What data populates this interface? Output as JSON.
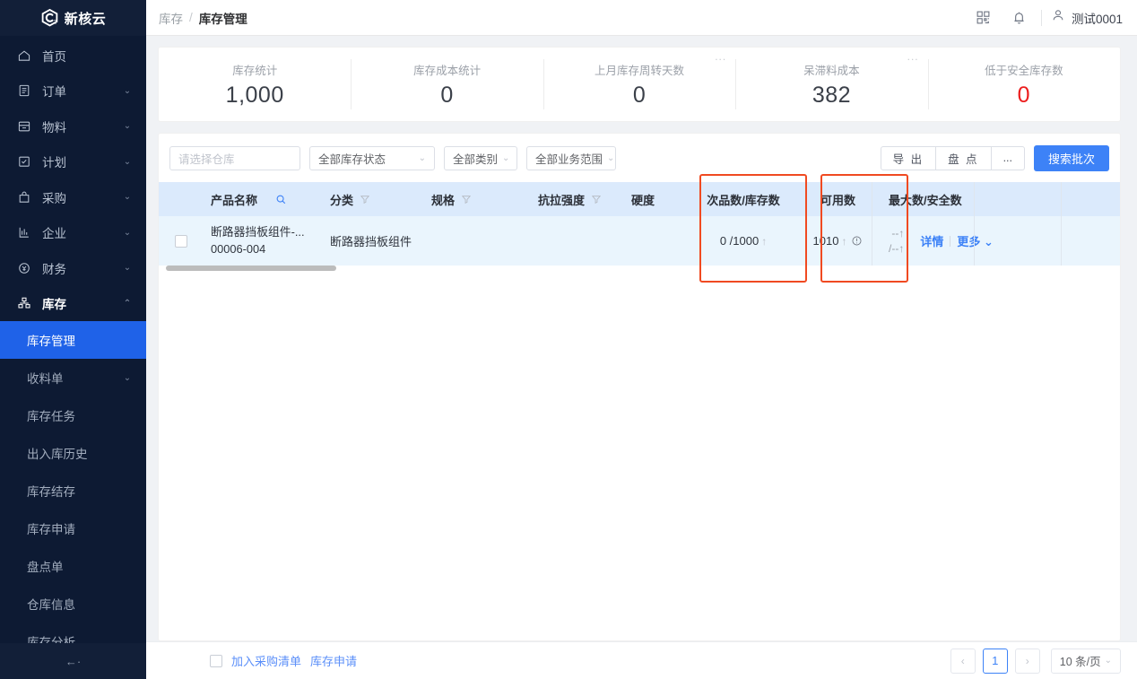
{
  "brand": {
    "name": "新核云",
    "logo_icon": "c2-hexagon-logo"
  },
  "sidebar": {
    "items": [
      {
        "label": "首页",
        "icon": "home-icon",
        "expandable": false
      },
      {
        "label": "订单",
        "icon": "order-icon",
        "expandable": true
      },
      {
        "label": "物料",
        "icon": "material-icon",
        "expandable": true
      },
      {
        "label": "计划",
        "icon": "plan-icon",
        "expandable": true
      },
      {
        "label": "采购",
        "icon": "purchase-icon",
        "expandable": true
      },
      {
        "label": "企业",
        "icon": "enterprise-icon",
        "expandable": true
      },
      {
        "label": "财务",
        "icon": "finance-icon",
        "expandable": true
      },
      {
        "label": "库存",
        "icon": "inventory-icon",
        "expandable": true,
        "expanded": true
      }
    ],
    "sub_items": [
      {
        "label": "库存管理",
        "selected": true
      },
      {
        "label": "收料单",
        "expandable": true
      },
      {
        "label": "库存任务"
      },
      {
        "label": "出入库历史"
      },
      {
        "label": "库存结存"
      },
      {
        "label": "库存申请"
      },
      {
        "label": "盘点单"
      },
      {
        "label": "仓库信息"
      },
      {
        "label": "库存分析"
      }
    ],
    "collapse_label": "←·"
  },
  "topbar": {
    "breadcrumb_parent": "库存",
    "breadcrumb_sep": "/",
    "breadcrumb_current": "库存管理",
    "qrcode_icon": "qrcode-icon",
    "bell_icon": "bell-icon",
    "user_icon": "user-avatar-icon",
    "user_name": "测试0001"
  },
  "stats": [
    {
      "label": "库存统计",
      "value": "1,000",
      "danger": false,
      "dots": false
    },
    {
      "label": "库存成本统计",
      "value": "0",
      "danger": false,
      "dots": false
    },
    {
      "label": "上月库存周转天数",
      "value": "0",
      "danger": false,
      "dots": true
    },
    {
      "label": "呆滞料成本",
      "value": "382",
      "danger": false,
      "dots": true
    },
    {
      "label": "低于安全库存数",
      "value": "0",
      "danger": true,
      "dots": false
    }
  ],
  "filters": {
    "warehouse_placeholder": "请选择仓库",
    "warehouse_value": "",
    "stock_status": "全部库存状态",
    "category": "全部类别",
    "business_scope": "全部业务范围",
    "export_button": "导 出",
    "stocktake_button": "盘 点",
    "more_button": "...",
    "search_button": "搜索批次"
  },
  "table": {
    "columns": [
      {
        "key": "check",
        "label": ""
      },
      {
        "key": "name",
        "label": "产品名称",
        "icon": "search-icon"
      },
      {
        "key": "cat",
        "label": "分类",
        "icon": "filter-icon"
      },
      {
        "key": "spec",
        "label": "规格",
        "icon": "filter-icon"
      },
      {
        "key": "ten",
        "label": "抗拉强度",
        "icon": "filter-icon"
      },
      {
        "key": "hard",
        "label": "硬度"
      },
      {
        "key": "defect",
        "label": "次品数/库存数"
      },
      {
        "key": "avail",
        "label": "可用数"
      },
      {
        "key": "maxsafe",
        "label": "最大数/安全数"
      }
    ],
    "rows": [
      {
        "name_line1": "断路器挡板组件-...",
        "name_line2": "00006-004",
        "cat": "断路器挡板组件",
        "spec": "",
        "ten": "",
        "hard": "",
        "defect": "0 /1000",
        "defect_arrow": "↑",
        "avail": "1010",
        "avail_arrow": "↑",
        "avail_warning_icon": "exclamation-circle-icon",
        "max": "--↑",
        "safe": "/--↑",
        "detail_link": "详情",
        "more_link": "更多"
      }
    ]
  },
  "highlights": [
    {
      "name": "defect-column-highlight",
      "color": "#f04a21"
    },
    {
      "name": "available-column-highlight",
      "color": "#f04a21"
    }
  ],
  "footer": {
    "checkbox_checked": false,
    "add_to_purchase_list": "加入采购清单",
    "stock_request": "库存申请",
    "prev_page": "‹",
    "current_page": "1",
    "next_page": "›",
    "page_size": "10 条/页"
  },
  "colors": {
    "sidebar_bg": "#0d1a33",
    "sidebar_selected": "#1f62e8",
    "primary": "#3d82f7",
    "danger": "#ec1d1d",
    "highlight": "#f04a21",
    "table_header": "#dbeafc",
    "table_row": "#eaf5fd"
  }
}
